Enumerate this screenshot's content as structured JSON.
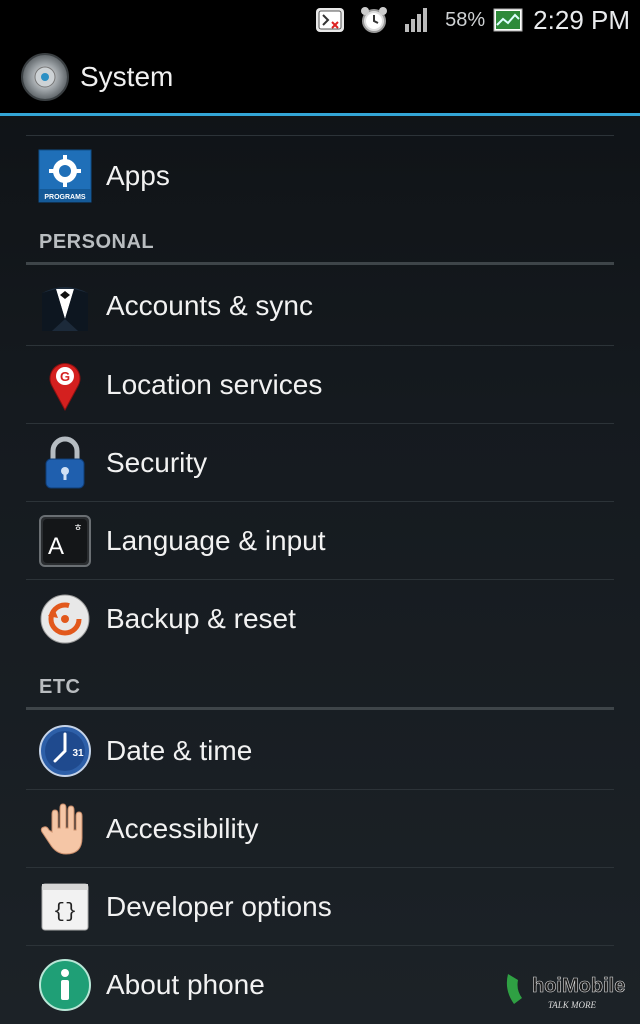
{
  "status_bar": {
    "battery_percent": "58%",
    "time": "2:29 PM",
    "icons": [
      "debug-icon",
      "alarm-clock-icon",
      "signal-icon",
      "battery-icon"
    ]
  },
  "action_bar": {
    "title": "System",
    "icon": "settings-disc-icon"
  },
  "top_items": [
    {
      "label": "Apps",
      "icon": "apps-programs-icon"
    }
  ],
  "sections": [
    {
      "header": "PERSONAL",
      "items": [
        {
          "label": "Accounts & sync",
          "icon": "tuxedo-icon"
        },
        {
          "label": "Location services",
          "icon": "location-pin-icon"
        },
        {
          "label": "Security",
          "icon": "padlock-icon"
        },
        {
          "label": "Language & input",
          "icon": "keyboard-key-icon"
        },
        {
          "label": "Backup & reset",
          "icon": "backup-restore-icon"
        }
      ]
    },
    {
      "header": "ETC",
      "items": [
        {
          "label": "Date & time",
          "icon": "clock-calendar-icon"
        },
        {
          "label": "Accessibility",
          "icon": "hand-icon"
        },
        {
          "label": "Developer options",
          "icon": "developer-braces-icon"
        },
        {
          "label": "About phone",
          "icon": "info-icon"
        }
      ]
    }
  ],
  "watermark": {
    "brand": "hoiMobile",
    "tagline": "TALK MORE"
  },
  "colors": {
    "accent": "#33a5d6",
    "background": "#151a1f",
    "text": "#f2f2f2",
    "section_header": "#b9bdc0"
  }
}
